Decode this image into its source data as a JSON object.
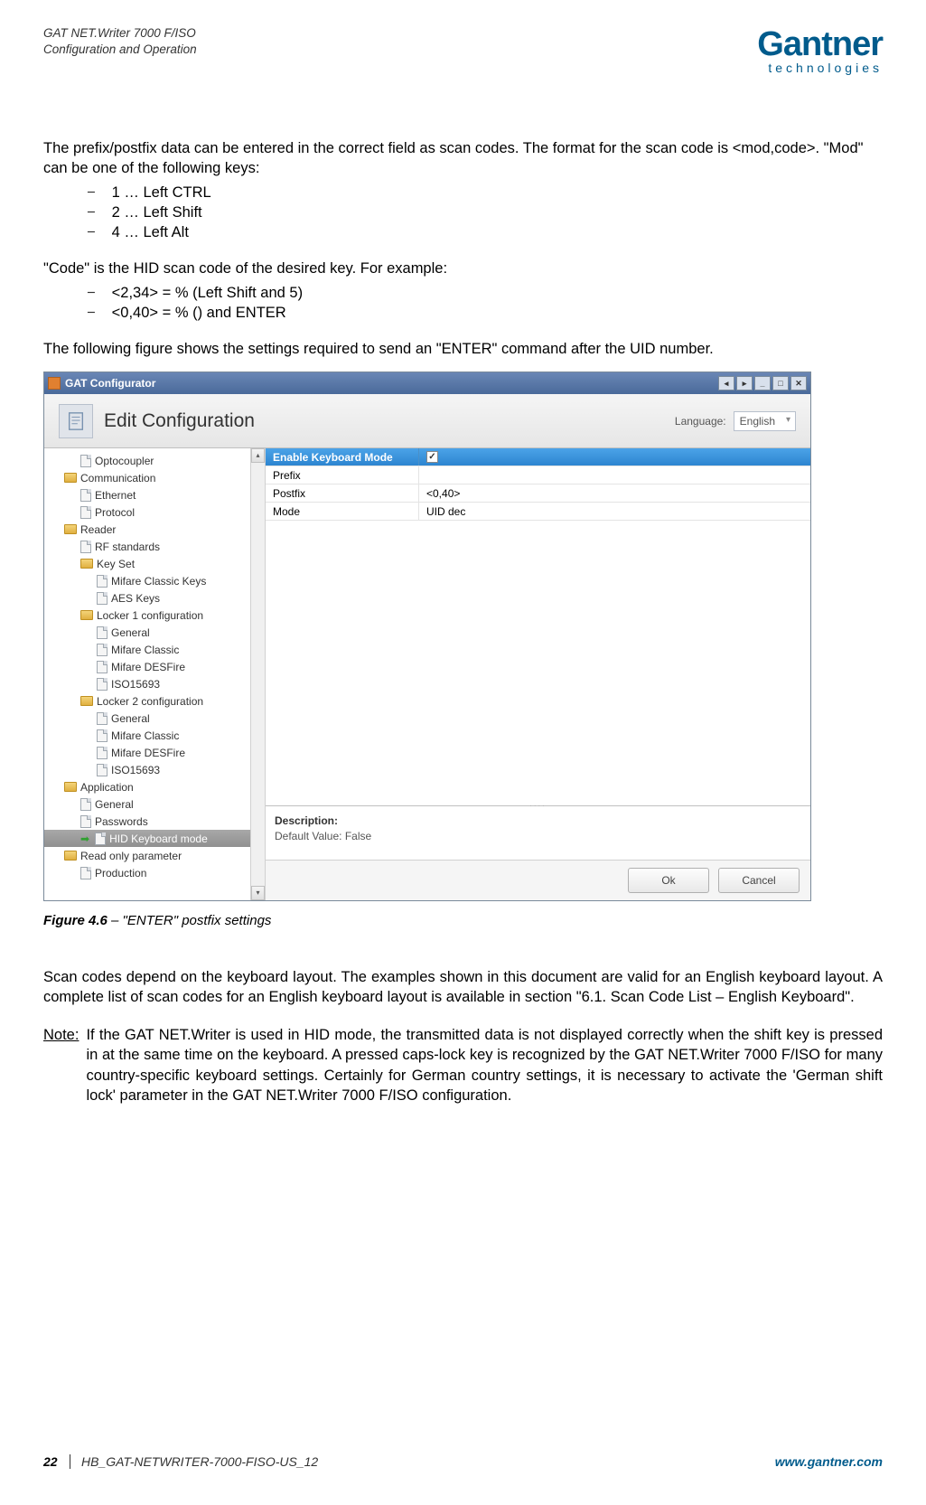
{
  "header": {
    "line1": "GAT NET.Writer 7000 F/ISO",
    "line2": "Configuration and Operation",
    "logo_main": "Gantner",
    "logo_sub": "technologies"
  },
  "body": {
    "p1": "The prefix/postfix data can be entered in the correct field as scan codes. The format for the scan code is <mod,code>. \"Mod\" can be one of the following keys:",
    "mod_list": [
      "1 … Left CTRL",
      "2 … Left Shift",
      "4 … Left Alt"
    ],
    "p2": "\"Code\" is the HID scan code of the desired key. For example:",
    "code_list": [
      "<2,34> = % (Left Shift and 5)",
      "<0,40> = % () and ENTER"
    ],
    "p3": "The following figure shows the settings required to send an \"ENTER\" command after the UID number.",
    "fig_caption_strong": "Figure 4.6",
    "fig_caption_rest": " – \"ENTER\" postfix settings",
    "p4": "Scan codes depend on the keyboard layout. The examples shown in this document are valid for an English keyboard layout. A complete list of scan codes for an English keyboard layout is available in section \"6.1. Scan Code List – English Keyboard\".",
    "note_label": "Note:",
    "note_text": "If the GAT NET.Writer is used in HID mode, the transmitted data is not displayed correctly when the shift key is pressed in at the same time on the keyboard. A pressed caps-lock key is recognized by the GAT NET.Writer 7000 F/ISO for many country-specific keyboard settings. Certainly for German country settings, it is necessary to activate the 'German shift lock' parameter in the GAT NET.Writer 7000 F/ISO configuration."
  },
  "app": {
    "title": "GAT Configurator",
    "ribbon_title": "Edit Configuration",
    "language_label": "Language:",
    "language_value": "English",
    "tree": [
      {
        "label": "Optocoupler",
        "icon": "file",
        "ind": 40
      },
      {
        "label": "Communication",
        "icon": "folder",
        "ind": 22
      },
      {
        "label": "Ethernet",
        "icon": "file",
        "ind": 40
      },
      {
        "label": "Protocol",
        "icon": "file",
        "ind": 40
      },
      {
        "label": "Reader",
        "icon": "folder",
        "ind": 22
      },
      {
        "label": "RF standards",
        "icon": "file",
        "ind": 40
      },
      {
        "label": "Key Set",
        "icon": "folder",
        "ind": 40
      },
      {
        "label": "Mifare Classic Keys",
        "icon": "file",
        "ind": 58
      },
      {
        "label": "AES Keys",
        "icon": "file",
        "ind": 58
      },
      {
        "label": "Locker 1 configuration",
        "icon": "folder",
        "ind": 40
      },
      {
        "label": "General",
        "icon": "file",
        "ind": 58
      },
      {
        "label": "Mifare Classic",
        "icon": "file",
        "ind": 58
      },
      {
        "label": "Mifare DESFire",
        "icon": "file",
        "ind": 58
      },
      {
        "label": "ISO15693",
        "icon": "file",
        "ind": 58
      },
      {
        "label": "Locker 2 configuration",
        "icon": "folder",
        "ind": 40
      },
      {
        "label": "General",
        "icon": "file",
        "ind": 58
      },
      {
        "label": "Mifare Classic",
        "icon": "file",
        "ind": 58
      },
      {
        "label": "Mifare DESFire",
        "icon": "file",
        "ind": 58
      },
      {
        "label": "ISO15693",
        "icon": "file",
        "ind": 58
      },
      {
        "label": "Application",
        "icon": "folder",
        "ind": 22
      },
      {
        "label": "General",
        "icon": "file",
        "ind": 40
      },
      {
        "label": "Passwords",
        "icon": "file",
        "ind": 40
      },
      {
        "label": "HID Keyboard mode",
        "icon": "file",
        "ind": 40,
        "sel": true,
        "arrow": true
      },
      {
        "label": "Read only parameter",
        "icon": "folder",
        "ind": 22
      },
      {
        "label": "Production",
        "icon": "file",
        "ind": 40
      }
    ],
    "props": [
      {
        "label": "Enable Keyboard Mode",
        "value": "",
        "checkbox": true,
        "header": true
      },
      {
        "label": "Prefix",
        "value": ""
      },
      {
        "label": "Postfix",
        "value": "<0,40>"
      },
      {
        "label": "Mode",
        "value": "UID dec"
      }
    ],
    "desc_label": "Description:",
    "desc_value": "Default Value: False",
    "ok_label": "Ok",
    "cancel_label": "Cancel"
  },
  "footer": {
    "page_num": "22",
    "doc_id": "HB_GAT-NETWRITER-7000-FISO-US_12",
    "site": "www.gantner.com"
  }
}
